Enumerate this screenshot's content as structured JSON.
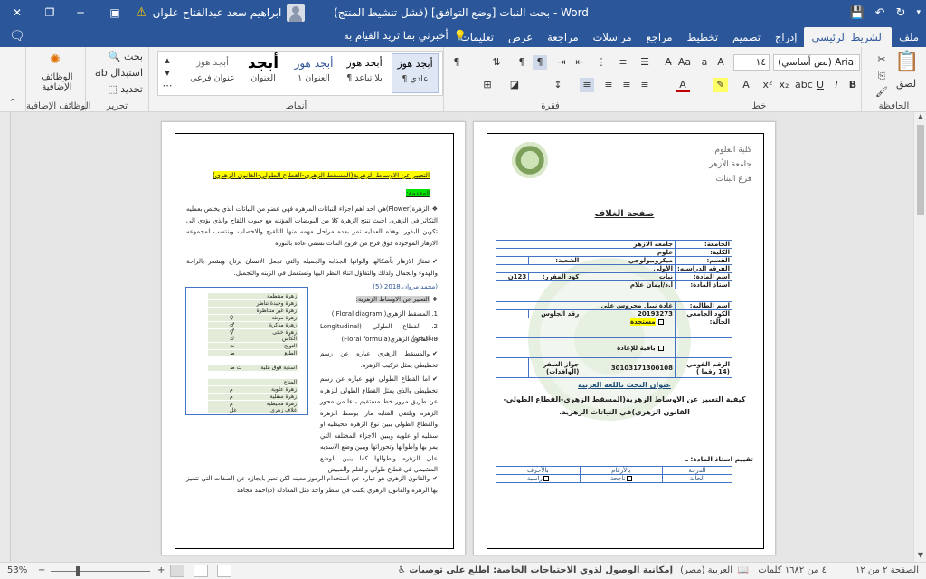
{
  "titlebar": {
    "title": "بحث النبات [وضع التوافق] (فشل تنشيط المنتج) - Word",
    "user_name": "ابراهيم سعد عبدالفتاح علوان",
    "warning_icon": "warning-icon",
    "colors": {
      "brand": "#2b579a"
    }
  },
  "tabs": [
    "ملف",
    "الشريط الرئيسي",
    "إدراج",
    "تصميم",
    "تخطيط",
    "مراجع",
    "مراسلات",
    "مراجعة",
    "عرض",
    "تعليمات"
  ],
  "tell_me": "أخبرني بما تريد القيام به",
  "ribbon": {
    "groups": {
      "clipboard": "الحافظة",
      "font": "خط",
      "paragraph": "فقرة",
      "styles": "أنماط",
      "editing": "تحرير",
      "addins": "الوظائف الإضافية"
    },
    "paste_label": "لصق",
    "font_name": "Arial (نص أساسي)",
    "font_size": "١٤",
    "styles": [
      {
        "sample": "أبجد هوز",
        "name": "¶ عادي"
      },
      {
        "sample": "أبجد هوز",
        "name": "¶ بلا تباعد"
      },
      {
        "sample": "أبجد هوز",
        "name": "العنوان ١"
      },
      {
        "sample": "أبجد",
        "name": "العنوان"
      },
      {
        "sample": "أبجد هوز",
        "name": "عنوان فرعي"
      }
    ],
    "find_label": "بحث",
    "replace_label": "استبدال",
    "select_label": "تحديد",
    "addins_label": "الوظائف الإضافية"
  },
  "cover": {
    "institution": [
      "كلية العلوم",
      "جامعة الأزهر",
      "فرع البنات"
    ],
    "title": "صفحة الغلاف",
    "rows": [
      {
        "key": "الجامعة:",
        "value": "جامعه الازهر",
        "key2": "",
        "value2": ""
      },
      {
        "key": "الكلية:",
        "value": "علوم",
        "key2": "",
        "value2": ""
      },
      {
        "key": "القسم:",
        "value": "ميكروبيولوجي",
        "key2": "الشعبة:",
        "value2": ""
      },
      {
        "key": "الفرقه الدراسيه:",
        "value": "الأولى",
        "key2": "",
        "value2": ""
      },
      {
        "key": "اسم المادة:",
        "value": "نبات",
        "key2": "كود المقرر:",
        "value2": "123ن"
      },
      {
        "key": "استاذ المادة:",
        "value": "أ.د/ايمان علام",
        "key2": "",
        "value2": ""
      },
      {
        "key": "",
        "value": "",
        "key2": "",
        "value2": ""
      },
      {
        "key": "اسم الطالبه:",
        "value": "غادة نبيل محروس علي",
        "key2": "",
        "value2": ""
      },
      {
        "key": "الكود الجامعي",
        "value": "20193273",
        "key2": "رقد الجلوس",
        "value2": ""
      },
      {
        "key": "الحالة:",
        "value": "مستجدة",
        "key2": "",
        "value2": ""
      },
      {
        "key": "",
        "value": "باقية للإعادة",
        "key2": "",
        "value2": ""
      },
      {
        "key": "الرقم القومي (14 رقما )",
        "value": "30103171300108",
        "key2": "جواز السفر (الوافدات)",
        "value2": ""
      }
    ],
    "research_heading": "عنوان البحث باللغة العربية",
    "research_title": "كيفية التعبير عن الاوساط الزهرية(المسقط الزهري-القطاع الطولي-القانون الزهري)في النباتات الزهرية.",
    "evaluation": "تقييم استاذ المادة: ـ",
    "grade_headers": [
      "الدرجة",
      "بالأرقام",
      "بالأحرف"
    ],
    "grade_status": [
      "الحالة",
      "ناجحة",
      "راسبة"
    ]
  },
  "content": {
    "title": "التعبير عن الاوساط الزهرية(المسقط الزهري-القطاع الطولي-القانون الزهري)",
    "intro_label": "المقدمة:",
    "p1": "الزهرة(Flower)هي احد اهم اجزاء النباتات المزهره فهي عضو من النباتات الذي يختص بعمليه التكاثر في الزهره. احيث تنتج الزهرة كلا من البويضات المؤنثه مع حبوب اللقاح والذي يؤدي الى تكوين البذور. وهذه العمليه تمر بعده مراحل مهمه منها التلقيح والاخصاب وينتسب لمجموعه الازهار الموجوده فوق فرع من فروع النبات تسمي عاده بالنوره",
    "p2": "تمتاز الازهار بأشكالها والوانها الجذابه والجميله والتي تجعل الانسان يرتاح ويشعر بالراحة والهدوء والجمال ولذلك والتفاؤل اثناء النظر اليها وتستعمل في الزينه والتجميل.",
    "ref": "(محمد مروان,2018)(5)",
    "methods_heading": "التعبير عن الاوساط الزهرية:",
    "methods": [
      "1. المسقط الزهري( Floral diagram )",
      "2. القطاع الطولي (Longitudinal section)",
      "3. القانون الزهري(Floral formula)"
    ],
    "p3": "والمسقط الزهري عباره عن رسم تخطيطي يمثل تركيب الزهره.",
    "p4": "اما القطاع الطولي فهو عباره عن رسم تخطيطي والذي يمثل القطاع الطولي للزهره عن طريق مرور خط مستقيم بدءا من محور الزهره ويلتقي القنابه مارا بوسط الزهرة والقطاع الطولي يبين نوع الزهره محيطيه او سفليه او علويه ويبين الاجزاء المختلفه التي يمر بها واطوالها وتحوراتها ويبين وضع الاسديه على الزهره واطوالها كما يبين الوضع المشيمي في قطاع طولي والقلم والمبيض",
    "p5": "والقانون الزهري هو عباره عن استخدام الرموز معينه لكن تعبر بايجازه عن الصفات التي تتميز بها الزهره والقانون الزهري يكتب في سطر واحد مثل المعادله (د/احمد مجاهد",
    "legend": [
      {
        "term": "زهرة منتظمة",
        "sym": ""
      },
      {
        "term": "زهرة وحيدة تناظر",
        "sym": ""
      },
      {
        "term": "زهرة غير متناظرة",
        "sym": ""
      },
      {
        "term": "زهرة مؤنثة",
        "sym": "♀"
      },
      {
        "term": "زهرة مذكرة",
        "sym": "♂"
      },
      {
        "term": "زهرة خنثى",
        "sym": "⚥"
      },
      {
        "term": "الكأس",
        "sym": "ك"
      },
      {
        "term": "التويج",
        "sym": "ت"
      },
      {
        "term": "الطلع",
        "sym": "ط"
      },
      {
        "term": "",
        "sym": ""
      },
      {
        "term": "اسدية فوق بتلية",
        "sym": "ت ط"
      },
      {
        "term": "",
        "sym": ""
      },
      {
        "term": "المتاع",
        "sym": ""
      },
      {
        "term": "زهرة علوية",
        "sym": "م"
      },
      {
        "term": "زهرة سفلية",
        "sym": "م"
      },
      {
        "term": "زهرة محيطية",
        "sym": "م"
      },
      {
        "term": "غلاف زهري",
        "sym": "غل"
      }
    ]
  },
  "statusbar": {
    "page_info": "الصفحة ٢ من ١٢",
    "word_count": "٤ من ١٦٨٢ كلمات",
    "language": "العربية (مصر)",
    "accessibility": "إمكانية الوصول لذوي الاحتياجات الخاصة: اطلع على توصيات",
    "zoom": "53%"
  }
}
